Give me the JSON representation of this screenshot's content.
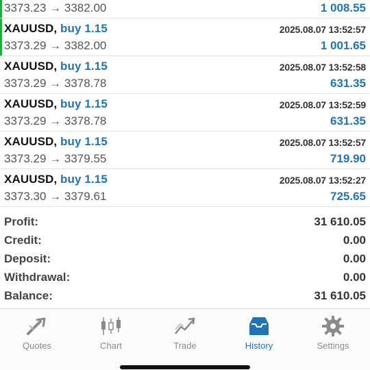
{
  "trades": [
    {
      "symbol": "",
      "side": "",
      "time": "",
      "prices": "3373.23 → 3382.00",
      "profit": "1 008.55",
      "partial": true,
      "highlight": true
    },
    {
      "symbol": "XAUUSD,",
      "side": "buy 1.15",
      "time": "2025.08.07 13:52:57",
      "prices": "3373.29 → 3382.00",
      "profit": "1 001.65",
      "partial": false,
      "highlight": true
    },
    {
      "symbol": "XAUUSD,",
      "side": "buy 1.15",
      "time": "2025.08.07 13:52:58",
      "prices": "3373.29 → 3378.78",
      "profit": "631.35",
      "partial": false,
      "highlight": false
    },
    {
      "symbol": "XAUUSD,",
      "side": "buy 1.15",
      "time": "2025.08.07 13:52:59",
      "prices": "3373.29 → 3378.78",
      "profit": "631.35",
      "partial": false,
      "highlight": false
    },
    {
      "symbol": "XAUUSD,",
      "side": "buy 1.15",
      "time": "2025.08.07 13:52:57",
      "prices": "3373.29 → 3379.55",
      "profit": "719.90",
      "partial": false,
      "highlight": false
    },
    {
      "symbol": "XAUUSD,",
      "side": "buy 1.15",
      "time": "2025.08.07 13:52:27",
      "prices": "3373.30 → 3379.61",
      "profit": "725.65",
      "partial": false,
      "highlight": false
    }
  ],
  "summary": {
    "profit_label": "Profit:",
    "profit_value": "31 610.05",
    "credit_label": "Credit:",
    "credit_value": "0.00",
    "deposit_label": "Deposit:",
    "deposit_value": "0.00",
    "withdrawal_label": "Withdrawal:",
    "withdrawal_value": "0.00",
    "balance_label": "Balance:",
    "balance_value": "31 610.05"
  },
  "tabs": [
    {
      "label": "Quotes",
      "icon": "quotes-icon",
      "active": false
    },
    {
      "label": "Chart",
      "icon": "chart-icon",
      "active": false
    },
    {
      "label": "Trade",
      "icon": "trade-icon",
      "active": false
    },
    {
      "label": "History",
      "icon": "history-icon",
      "active": true
    },
    {
      "label": "Settings",
      "icon": "settings-icon",
      "active": false
    }
  ],
  "colors": {
    "accent": "#1f73b7",
    "highlight_bar": "#27a844",
    "inactive": "#8a8a8a"
  }
}
